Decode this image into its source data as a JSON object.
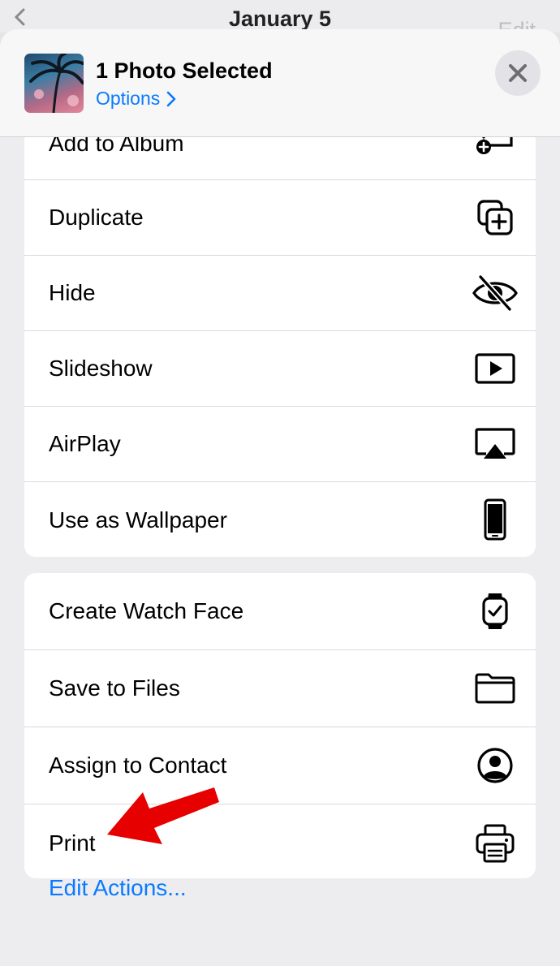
{
  "background": {
    "title": "January 5",
    "edit_label": "Edit"
  },
  "header": {
    "title": "1 Photo Selected",
    "options_label": "Options",
    "close_icon": "close-icon"
  },
  "group1": [
    {
      "label": "Add to Album",
      "icon": "add-to-album-icon"
    },
    {
      "label": "Duplicate",
      "icon": "duplicate-icon"
    },
    {
      "label": "Hide",
      "icon": "eye-slash-icon"
    },
    {
      "label": "Slideshow",
      "icon": "play-rectangle-icon"
    },
    {
      "label": "AirPlay",
      "icon": "airplay-icon"
    },
    {
      "label": "Use as Wallpaper",
      "icon": "iphone-icon"
    }
  ],
  "group2": [
    {
      "label": "Create Watch Face",
      "icon": "watch-icon"
    },
    {
      "label": "Save to Files",
      "icon": "folder-icon"
    },
    {
      "label": "Assign to Contact",
      "icon": "person-circle-icon"
    },
    {
      "label": "Print",
      "icon": "printer-icon"
    }
  ],
  "footer": {
    "edit_actions_label": "Edit Actions..."
  },
  "colors": {
    "accent": "#0a7aff",
    "annotation_arrow": "#e60000"
  }
}
